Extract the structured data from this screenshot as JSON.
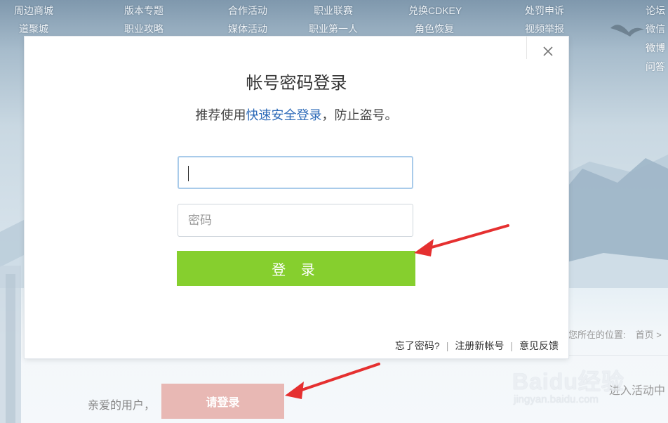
{
  "nav": {
    "row1": [
      "周边商城",
      "版本专题",
      "合作活动",
      "职业联赛",
      "兑换CDKEY",
      "处罚申诉",
      "论坛"
    ],
    "row2": [
      "道聚城",
      "职业攻略",
      "媒体活动",
      "职业第一人",
      "角色恢复",
      "视频举报",
      "微信"
    ],
    "right_extra": [
      "微博",
      "问答"
    ]
  },
  "modal": {
    "title": "帐号密码登录",
    "subtitle_pre": "推荐使用",
    "subtitle_link": "快速安全登录",
    "subtitle_post": "，防止盗号。",
    "account_placeholder": "",
    "password_placeholder": "密码",
    "login_label": "登 录",
    "forgot": "忘了密码?",
    "register": "注册新帐号",
    "feedback": "意见反馈",
    "separator": "|"
  },
  "page": {
    "location_label": "您所在的位置:",
    "location_home": "首页 >",
    "greeting": "亲爱的用户，",
    "please_login": "请登录",
    "enter_activity": "进入活动中"
  },
  "watermark": {
    "brand": "Baidu经验",
    "url": "jingyan.baidu.com"
  },
  "colors": {
    "login_button": "#86cf2e",
    "link": "#2e6bb8",
    "please_login_bg": "#e8b8b4",
    "arrow": "#e53030"
  }
}
